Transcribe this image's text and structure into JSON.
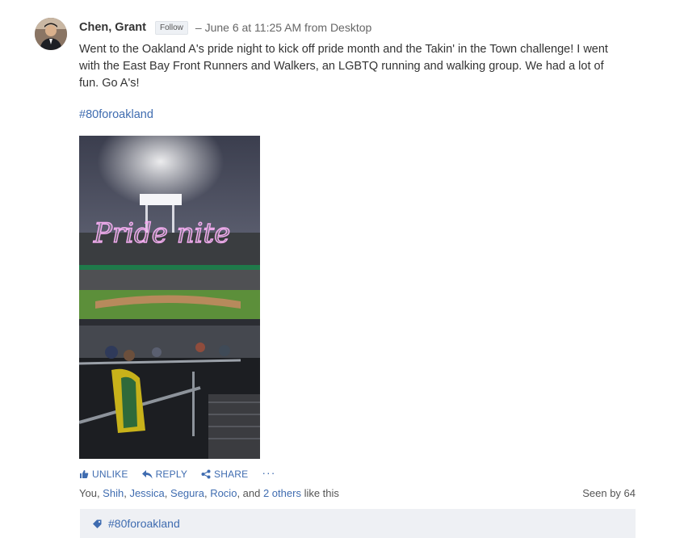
{
  "post": {
    "author": "Chen, Grant",
    "follow_label": "Follow",
    "meta": "– June 6 at 11:25 AM from Desktop",
    "body": "Went to the Oakland A's pride night to kick off pride month and the Takin' in the Town challenge!  I went with the East Bay Front Runners and Walkers, an LGBTQ running and walking group.  We had a lot of fun.  Go A's!",
    "hashtag": "#80foroakland",
    "photo_caption": "Pride nite"
  },
  "actions": {
    "unlike": "UNLIKE",
    "reply": "REPLY",
    "share": "SHARE",
    "more": "···"
  },
  "likes": {
    "prefix": "You, ",
    "names": [
      "Shih",
      "Jessica",
      "Segura",
      "Rocio"
    ],
    "conjunction": ", and ",
    "others": "2 others",
    "suffix": " like this",
    "seen_by": "Seen by 64"
  },
  "topic": {
    "label": "#80foroakland"
  },
  "colors": {
    "link": "#3f6cb0",
    "text": "#333333",
    "topic_bg": "#eef0f4"
  }
}
